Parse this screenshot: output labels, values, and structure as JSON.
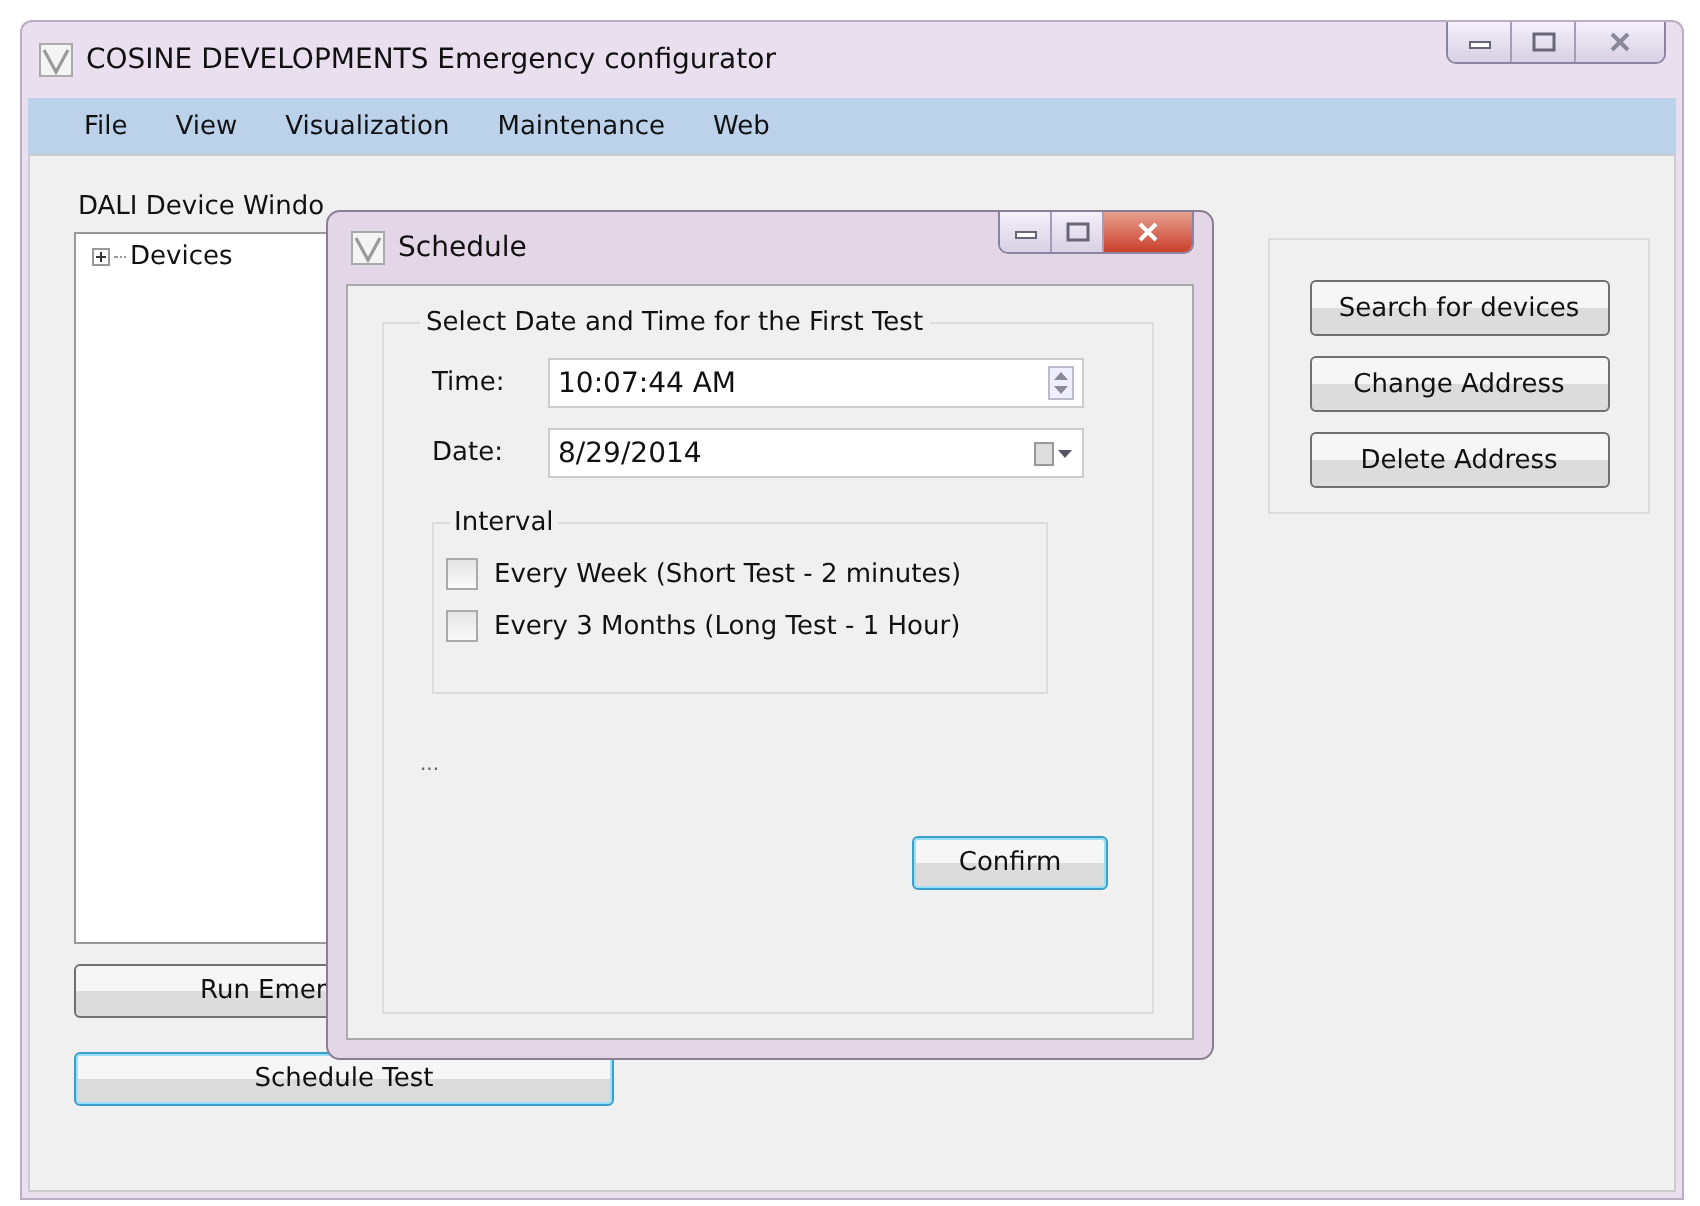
{
  "window": {
    "title": "COSINE DEVELOPMENTS Emergency configurator"
  },
  "menu": [
    "File",
    "View",
    "Visualization",
    "Maintenance",
    "Web"
  ],
  "device_group": {
    "title": "DALI Device Windo",
    "tree": [
      {
        "label": "Devices",
        "expanded": false
      }
    ]
  },
  "left_buttons": [
    "Run Emer",
    "Schedule Test"
  ],
  "right_buttons": [
    "Search for devices",
    "Change Address",
    "Delete Address"
  ],
  "dialog": {
    "title": "Schedule",
    "group_title": "Select Date and Time for the First Test",
    "fields": [
      {
        "label": "Time:",
        "value": "10:07:44 AM",
        "kind": "spinner"
      },
      {
        "label": "Date:",
        "value": "8/29/2014",
        "kind": "date"
      }
    ],
    "interval": {
      "title": "Interval",
      "options": [
        {
          "label": "Every Week (Short Test - 2 minutes)",
          "checked": false
        },
        {
          "label": "Every 3 Months (Long Test - 1 Hour)",
          "checked": false
        }
      ]
    },
    "status": "...",
    "button": "Confirm"
  }
}
